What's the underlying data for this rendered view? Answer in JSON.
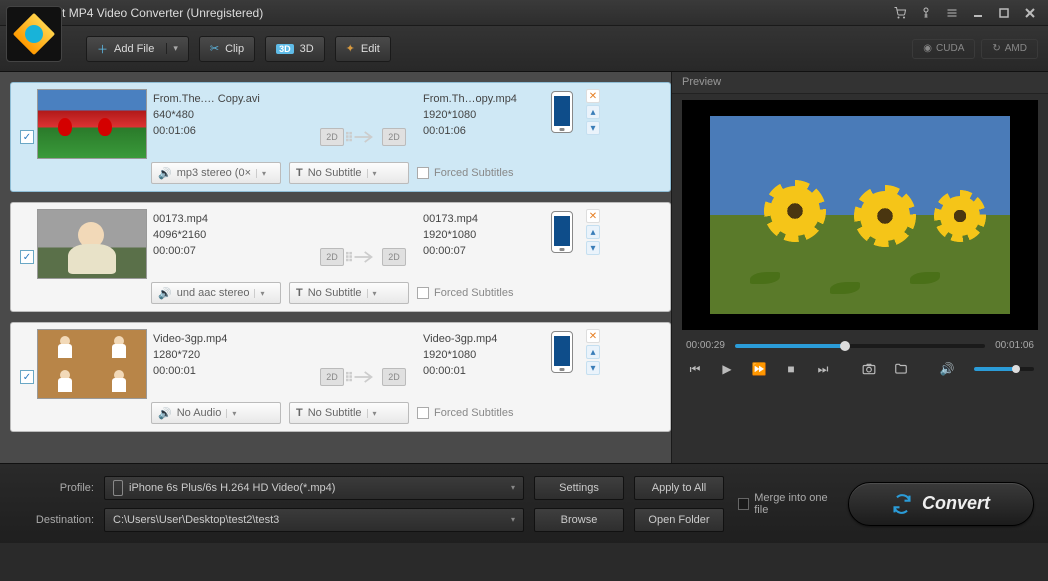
{
  "title": "Aiseesoft MP4 Video Converter (Unregistered)",
  "toolbar": {
    "add_file": "Add File",
    "clip": "Clip",
    "three_d": "3D",
    "edit": "Edit",
    "cuda": "CUDA",
    "amd": "AMD"
  },
  "items": [
    {
      "src_name": "From.The.… Copy.avi",
      "src_res": "640*480",
      "src_dur": "00:01:06",
      "out_name": "From.Th…opy.mp4",
      "out_res": "1920*1080",
      "out_dur": "00:01:06",
      "audio": "mp3 stereo (0×",
      "subtitle": "No Subtitle",
      "forced": "Forced Subtitles",
      "selected": true
    },
    {
      "src_name": "00173.mp4",
      "src_res": "4096*2160",
      "src_dur": "00:00:07",
      "out_name": "00173.mp4",
      "out_res": "1920*1080",
      "out_dur": "00:00:07",
      "audio": "und aac stereo",
      "subtitle": "No Subtitle",
      "forced": "Forced Subtitles",
      "selected": false
    },
    {
      "src_name": "Video-3gp.mp4",
      "src_res": "1280*720",
      "src_dur": "00:00:01",
      "out_name": "Video-3gp.mp4",
      "out_res": "1920*1080",
      "out_dur": "00:00:01",
      "audio": "No Audio",
      "subtitle": "No Subtitle",
      "forced": "Forced Subtitles",
      "selected": false
    }
  ],
  "badges": {
    "twod": "2D"
  },
  "preview": {
    "label": "Preview",
    "cur_time": "00:00:29",
    "total_time": "00:01:06",
    "progress_pct": 44
  },
  "footer": {
    "profile_label": "Profile:",
    "profile_value": "iPhone 6s Plus/6s H.264 HD Video(*.mp4)",
    "dest_label": "Destination:",
    "dest_value": "C:\\Users\\User\\Desktop\\test2\\test3",
    "settings": "Settings",
    "apply_all": "Apply to All",
    "browse": "Browse",
    "open_folder": "Open Folder",
    "merge": "Merge into one file",
    "convert": "Convert"
  }
}
